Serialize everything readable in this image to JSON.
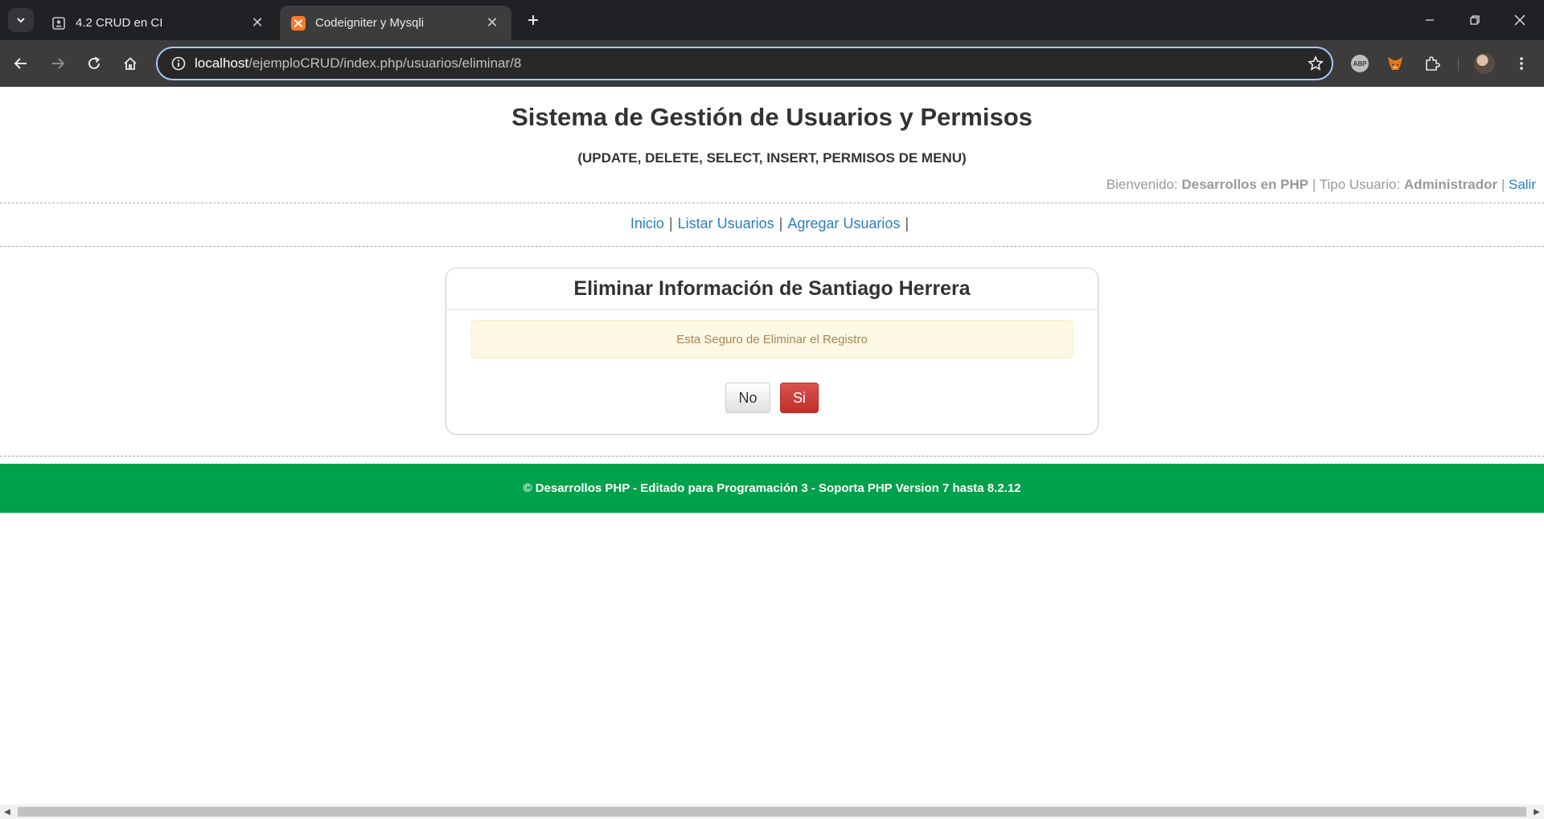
{
  "browser": {
    "tabs": [
      {
        "title": "4.2 CRUD en CI",
        "favicon": "contact-icon"
      },
      {
        "title": "Codeigniter y Mysqli",
        "favicon": "xampp-icon"
      }
    ],
    "url_host": "localhost",
    "url_path": "/ejemploCRUD/index.php/usuarios/eliminar/8",
    "extensions": {
      "abp_label": "ABP"
    }
  },
  "header": {
    "title": "Sistema de Gestión de Usuarios y Permisos",
    "subtitle": "(UPDATE, DELETE, SELECT, INSERT, PERMISOS DE MENU)",
    "welcome_label": "Bienvenido:",
    "user_name": "Desarrollos en PHP",
    "sep1": "|",
    "user_type_label": "Tipo Usuario:",
    "user_type": "Administrador",
    "sep2": "|",
    "logout": "Salir"
  },
  "menu": {
    "items": [
      {
        "label": "Inicio"
      },
      {
        "label": "Listar Usuarios"
      },
      {
        "label": "Agregar Usuarios"
      }
    ],
    "separator": "|"
  },
  "panel": {
    "title": "Eliminar Información de Santiago Herrera",
    "alert": "Esta Seguro de Eliminar el Registro",
    "no_label": "No",
    "si_label": "Si"
  },
  "footer": {
    "text": "© Desarrollos PHP - Editado para Programación 3 - Soporta PHP Version 7 hasta 8.2.12"
  },
  "colors": {
    "link": "#2a7fc1",
    "footer_bg": "#00a14b",
    "danger": "#d9534f",
    "alert_bg": "#fcf8e3"
  }
}
